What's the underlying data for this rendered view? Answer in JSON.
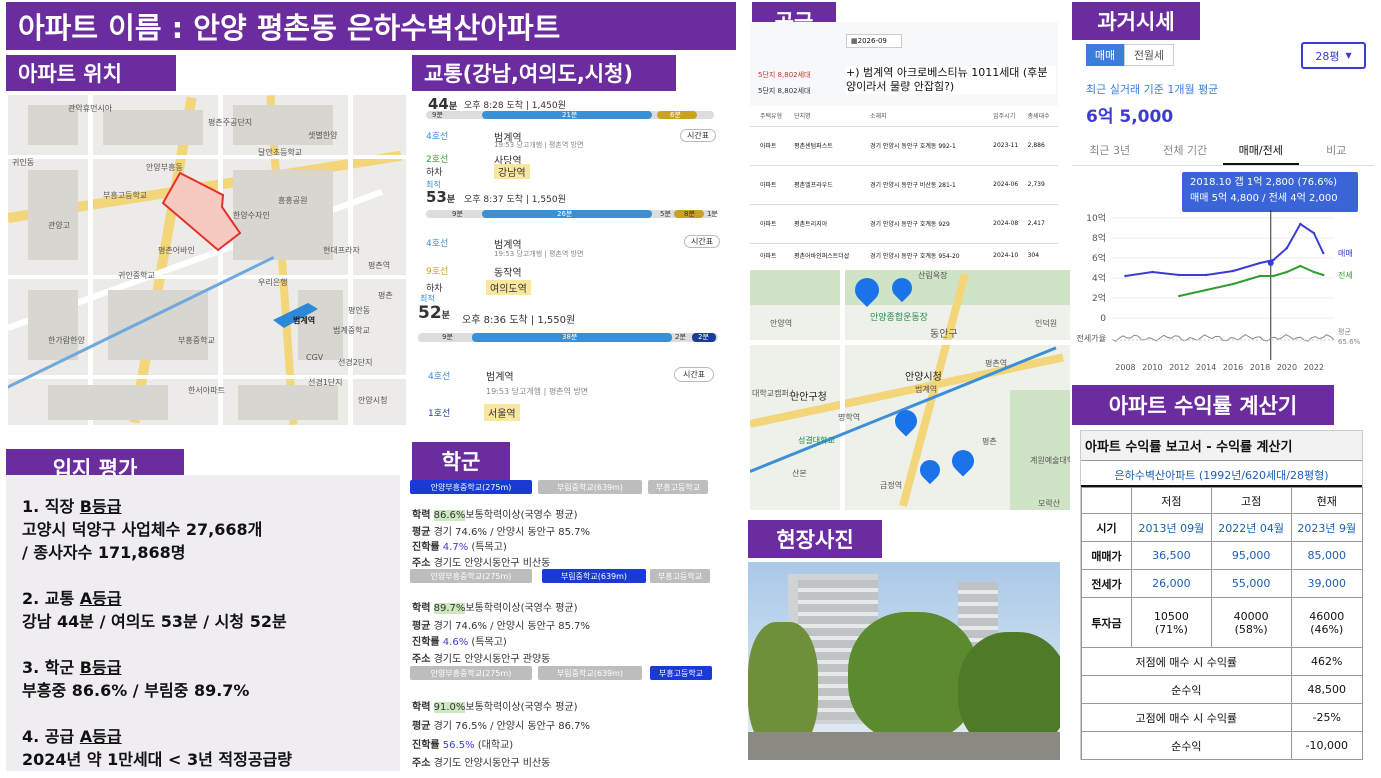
{
  "title": "아파트 이름 : 안양 평촌동 은하수벽산아파트",
  "headers": {
    "location": "아파트 위치",
    "traffic": "교통(강남,여의도,시청)",
    "supply": "공급",
    "past_price": "과거시세",
    "evaluation": "입지 평가",
    "school": "학군",
    "site_photo": "현장사진",
    "calculator": "아파트 수익률 계산기"
  },
  "evaluation": {
    "items": [
      {
        "num": "1. 직장 ",
        "grade": "B등급",
        "l2": "고양시 덕양구 사업체수 27,668개",
        "l3": "/ 종사자수 171,868명"
      },
      {
        "num": "2. 교통 ",
        "grade": "A등급",
        "l2": "강남 44분 / 여의도 53분 / 시청 52분"
      },
      {
        "num": "3. 학군 ",
        "grade": "B등급",
        "l2": "부흥중 86.6% / 부림중 89.7%"
      },
      {
        "num": "4. 공급 ",
        "grade": "A등급",
        "l2": "2024년 약 1만세대 < 3년 적정공급량"
      }
    ]
  },
  "map_labels": [
    "관악휴먼시아",
    "평촌주공단지",
    "샛별한양",
    "달안초등학교",
    "부흥고등학교",
    "안양부흥동",
    "귀인동",
    "한양수자인",
    "흥흥공원",
    "관양고",
    "평촌어바인",
    "범계역",
    "우리은행",
    "평촌역",
    "범계중학교",
    "CGV",
    "선경2단지",
    "부흥중학교",
    "현대프라자",
    "귀인중학교",
    "평촌",
    "안양시청",
    "평안동",
    "선경1단지",
    "한가람한양",
    "한서아파트"
  ],
  "traffic": {
    "routes": [
      {
        "time_min": "44",
        "time_unit": "분",
        "detail": "오후 8:28 도착 | 1,450원",
        "seg": [
          "9분",
          "21분",
          "6분"
        ],
        "steps": [
          {
            "line": "4호선",
            "st": "범계역",
            "time": "19:53 당고개행 | 평촌역 방면",
            "btn": "시간표"
          },
          {
            "line": "2호선",
            "st": "사당역"
          },
          {
            "line": "하차",
            "st": "강남역"
          }
        ]
      },
      {
        "tag": "최적",
        "time_min": "53",
        "time_unit": "분",
        "detail": "오후 8:37 도착 | 1,550원",
        "seg": [
          "9분",
          "26분",
          "5분",
          "8분",
          "1분"
        ],
        "steps": [
          {
            "line": "4호선",
            "st": "범계역",
            "time": "19:53 당고개행 | 평촌역 방면",
            "btn": "시간표"
          },
          {
            "line": "9호선",
            "st": "동작역"
          },
          {
            "line": "하차",
            "st": "여의도역"
          }
        ]
      },
      {
        "tag": "최적",
        "time_min": "52",
        "time_unit": "분",
        "detail": "오후 8:36 도착 | 1,550원",
        "seg": [
          "9분",
          "38분",
          "2분",
          "2분"
        ],
        "steps": [
          {
            "line": "4호선",
            "st": "범계역",
            "time": "19:53 당고개행 | 평촌역 방면",
            "btn": "시간표"
          },
          {
            "line": "1호선",
            "st": "서울역"
          }
        ]
      }
    ]
  },
  "supply": {
    "date_chip": "2026-09",
    "stat1": "5단지 8,802세대",
    "stat2": "5단지 8,802세대",
    "note": "+) 범계역 아크로베스티뉴 1011세대 (후분양이라서 물량 안잡힘?)",
    "cols": [
      "주택유형",
      "단지명",
      "소재지",
      "입주시기",
      "총세대수"
    ],
    "rows": [
      [
        "아파트",
        "평촌센텀퍼스트",
        "경기 안양시 동안구 호계동 992-1",
        "2023-11",
        "2,886"
      ],
      [
        "아파트",
        "평촌엘프라우드",
        "경기 안양시 동안구 비산동 281-1",
        "2024-06",
        "2,739"
      ],
      [
        "아파트",
        "평촌트리지아",
        "경기 안양시 동안구 호계동 929",
        "2024-08",
        "2,417"
      ],
      [
        "아파트",
        "평촌어바인퍼스트더샵",
        "경기 안양시 동안구 호계동 954-20",
        "2024-10",
        "304"
      ]
    ],
    "map_labels": [
      "산림욕장",
      "안양종합운동장",
      "동안구",
      "인덕원",
      "안양역",
      "안양시청",
      "범계역",
      "평촌역",
      "만안구청",
      "명학역",
      "대학교캠퍼스",
      "성결대학교",
      "평촌",
      "계원예술대학교",
      "금정역",
      "산본",
      "모락산"
    ]
  },
  "past_price": {
    "tabs": [
      "매매",
      "전월세"
    ],
    "size": "28평",
    "caption": "최근 실거래 기준 1개월 평균",
    "price": "6억 5,000",
    "ranges": [
      "최근 3년",
      "전체 기간",
      "매매/전세",
      "비교"
    ],
    "tooltip1": "2018.10  갭 1억 2,800 (76.6%)",
    "tooltip2": "매매 5억 4,800 / 전세 4억 2,000",
    "yticks": [
      "10억",
      "8억",
      "6억",
      "4억",
      "2억",
      "0"
    ],
    "xticks": [
      "2008",
      "2010",
      "2012",
      "2014",
      "2016",
      "2018",
      "2020",
      "2022"
    ],
    "legend_sale": "매매",
    "legend_rent": "전세",
    "rate_label": "전세가율",
    "rate_legend": "평균",
    "rate_value": "65.6%",
    "colors": {
      "sale": "#3b3bd6",
      "rent": "#2f9e2f",
      "rate": "#888888"
    }
  },
  "chart_data": {
    "type": "line",
    "title": "",
    "xlabel": "",
    "ylabel": "",
    "ylim": [
      0,
      10
    ],
    "unit": "억",
    "x": [
      2008,
      2010,
      2012,
      2014,
      2016,
      2018,
      2019,
      2020,
      2021,
      2022,
      2022.7
    ],
    "series": [
      {
        "name": "매매",
        "values": [
          4.2,
          4.6,
          4.3,
          4.3,
          4.7,
          5.5,
          5.8,
          7.0,
          9.4,
          8.5,
          6.5
        ]
      },
      {
        "name": "전세",
        "values": [
          null,
          null,
          2.2,
          2.8,
          3.4,
          4.2,
          4.2,
          4.6,
          5.2,
          4.6,
          4.3
        ]
      }
    ]
  },
  "school": {
    "tabs": [
      {
        "t1": "안양부흥중학교",
        "t1d": "(275m)",
        "t2": "부림중학교",
        "t2d": "(639m)",
        "t3": "부흥고등학교",
        "active": 0,
        "rate": "86.6%",
        "rate_txt": "보통학력이상(국영수 평균)",
        "avg": "경기 74.6% / 안양시 동안구 85.7%",
        "adv": "4.7%",
        "adv_txt": "(특목고)",
        "addr": "경기도 안양시동안구 비산동"
      },
      {
        "t1": "안양부흥중학교",
        "t1d": "(275m)",
        "t2": "부림중학교",
        "t2d": "(639m)",
        "t3": "부흥고등학교",
        "active": 1,
        "rate": "89.7%",
        "rate_txt": "보통학력이상(국영수 평균)",
        "avg": "경기 74.6% / 안양시 동안구 85.7%",
        "adv": "4.6%",
        "adv_txt": "(특목고)",
        "addr": "경기도 안양시동안구 관양동"
      },
      {
        "t1": "안양부흥중학교",
        "t1d": "(275m)",
        "t2": "부림중학교",
        "t2d": "(639m)",
        "t3": "부흥고등학교",
        "active": 2,
        "rate": "91.0%",
        "rate_txt": "보통학력이상(국영수 평균)",
        "avg": "경기 76.5% / 안양시 동안구 86.7%",
        "adv": "56.5%",
        "adv_txt": "(대학교)",
        "addr": "경기도 안양시동안구 비산동"
      }
    ],
    "labels": {
      "rate": "학력",
      "avg": "평균",
      "adv": "진학률",
      "addr": "주소"
    }
  },
  "calculator": {
    "report_title": "아파트 수익률 보고서 - 수익률 계산기",
    "apt": "은하수벽산아파트 (1992년/620세대/28평형)",
    "cols": [
      "",
      "저점",
      "고점",
      "현재"
    ],
    "rows": [
      [
        "시기",
        "2013년 09월",
        "2022년 04월",
        "2023년 9월"
      ],
      [
        "매매가",
        "36,500",
        "95,000",
        "85,000"
      ],
      [
        "전세가",
        "26,000",
        "55,000",
        "39,000"
      ]
    ],
    "invest": {
      "label": "투자금",
      "vals": [
        "10500",
        "40000",
        "46000"
      ],
      "pct": [
        "(71%)",
        "(58%)",
        "(46%)"
      ]
    },
    "summary": [
      [
        "저점에 매수 시 수익률",
        "462%"
      ],
      [
        "순수익",
        "48,500"
      ],
      [
        "고점에 매수 시 수익률",
        "-25%"
      ],
      [
        "순수익",
        "-10,000"
      ]
    ]
  }
}
